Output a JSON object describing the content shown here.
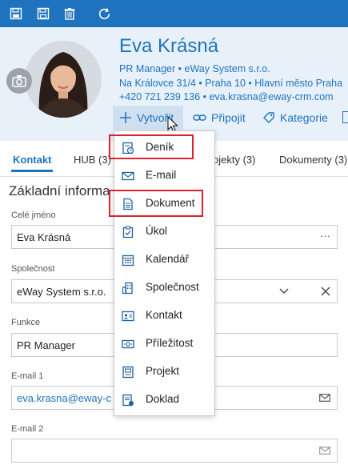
{
  "colors": {
    "accent": "#1e73be",
    "highlight": "#d9232d",
    "header_bg": "#e8f1f9"
  },
  "toolbar": {
    "icons": [
      "save-close-icon",
      "save-icon",
      "delete-icon",
      "refresh-icon"
    ]
  },
  "contact": {
    "name": "Eva Krásná",
    "subtitle": "PR Manager • eWay System s.r.o.",
    "address": "Na Královce 31/4 • Praha 10 • Hlavní město Praha",
    "contacts": "+420 721 239 136 • eva.krasna@eway-crm.com"
  },
  "actions": {
    "create": "Vytvořit",
    "link": "Připojit",
    "category": "Kategorie"
  },
  "tabs": [
    {
      "label": "Kontakt",
      "active": true
    },
    {
      "label": "HUB (3)"
    },
    {
      "label": "ojekty (3)"
    },
    {
      "label": "Dokumenty (3)"
    }
  ],
  "form": {
    "section_title": "Základní informa",
    "full_name_label": "Celé jméno",
    "full_name_value": "Eva Krásná",
    "company_label": "Společnost",
    "company_value": "eWay System s.r.o.",
    "function_label": "Funkce",
    "function_value": "PR Manager",
    "email1_label": "E-mail 1",
    "email1_value": "eva.krasna@eway-c",
    "email2_label": "E-mail 2",
    "email2_value": ""
  },
  "menu": {
    "items": [
      {
        "label": "Deník",
        "icon": "journal-icon",
        "highlighted": true
      },
      {
        "label": "E-mail",
        "icon": "email-icon"
      },
      {
        "label": "Dokument",
        "icon": "document-icon",
        "highlighted": true
      },
      {
        "label": "Úkol",
        "icon": "task-icon"
      },
      {
        "label": "Kalendář",
        "icon": "calendar-icon"
      },
      {
        "label": "Společnost",
        "icon": "company-icon"
      },
      {
        "label": "Kontakt",
        "icon": "contact-icon"
      },
      {
        "label": "Příležitost",
        "icon": "opportunity-icon"
      },
      {
        "label": "Projekt",
        "icon": "project-icon"
      },
      {
        "label": "Doklad",
        "icon": "invoice-icon"
      }
    ]
  }
}
